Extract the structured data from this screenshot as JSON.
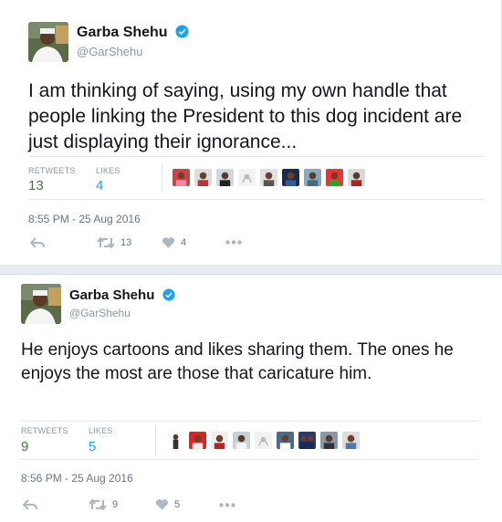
{
  "tweets": [
    {
      "display_name": "Garba Shehu",
      "handle": "@GarShehu",
      "text": "I am thinking of saying, using my own handle that people linking the President to this dog incident are just displaying their ignorance...",
      "retweets_label": "RETWEETS",
      "retweets": "13",
      "likes_label": "LIKES",
      "likes": "4",
      "timestamp": "8:55 PM - 25 Aug 2016",
      "action_retweets": "13",
      "action_likes": "4"
    },
    {
      "display_name": "Garba Shehu",
      "handle": "@GarShehu",
      "text": "He enjoys cartoons and likes sharing them. The  ones he enjoys the most are those that caricature him.",
      "retweets_label": "RETWEETS",
      "retweets": "9",
      "likes_label": "LIKES",
      "likes": "5",
      "timestamp": "8:56 PM - 25 Aug 2016",
      "action_retweets": "9",
      "action_likes": "5"
    }
  ],
  "colors": {
    "accent": "#1da1f2",
    "retweet_count": "#3d7a33",
    "muted": "#8899a6",
    "text": "#14171a",
    "verified": "#1da1f2"
  },
  "icons": [
    "verified-badge-icon",
    "reply-icon",
    "retweet-icon",
    "heart-icon",
    "more-icon"
  ]
}
